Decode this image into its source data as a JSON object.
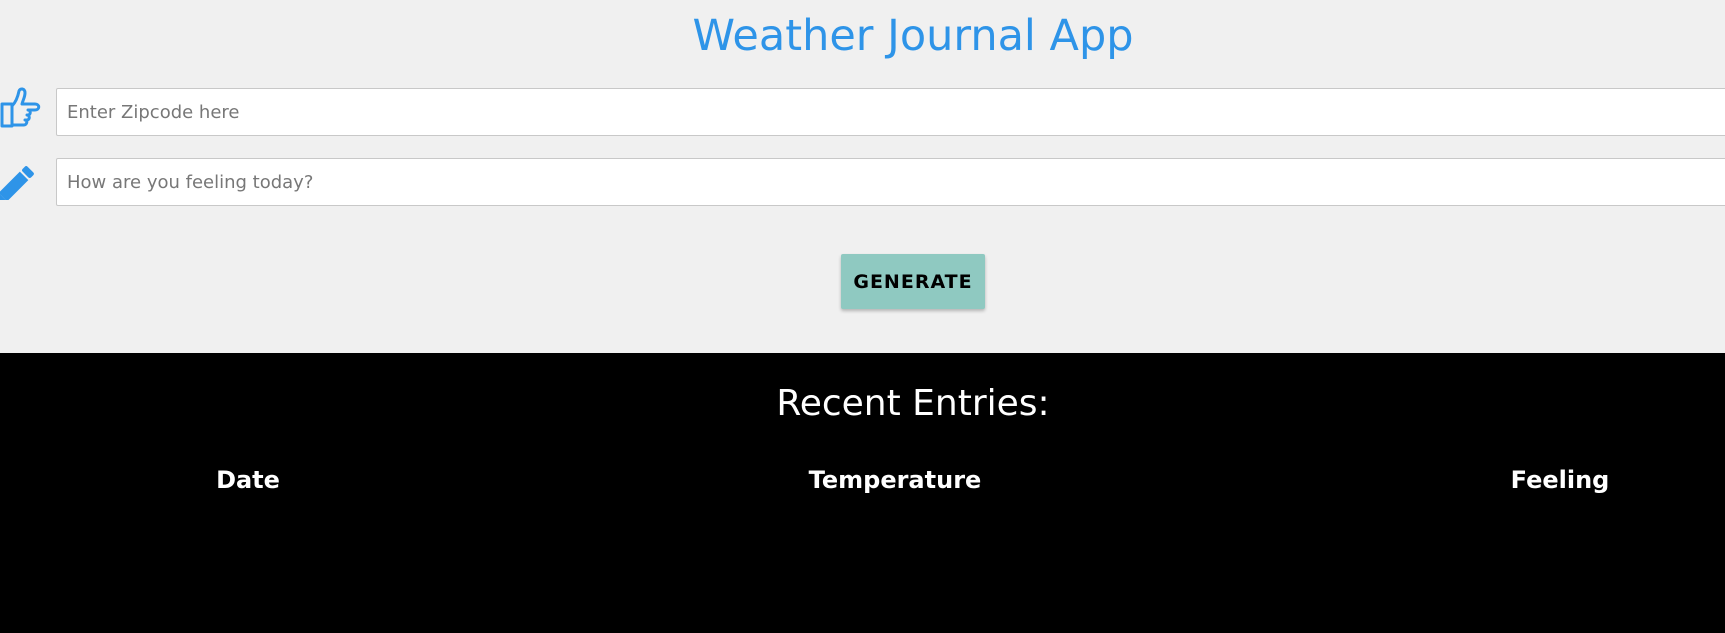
{
  "header": {
    "title": "Weather Journal App"
  },
  "form": {
    "zip": {
      "icon": "pointing-hand-icon",
      "placeholder": "Enter Zipcode here",
      "value": ""
    },
    "feelings": {
      "icon": "pencil-icon",
      "placeholder": "How are you feeling today?",
      "value": ""
    },
    "generate_label": "GENERATE"
  },
  "entries": {
    "title": "Recent Entries:",
    "columns": [
      "Date",
      "Temperature",
      "Feeling"
    ]
  },
  "colors": {
    "accent": "#2e94e8",
    "button": "#8fc9c1",
    "top_background": "#f0f0f0",
    "bottom_background": "#000000"
  }
}
